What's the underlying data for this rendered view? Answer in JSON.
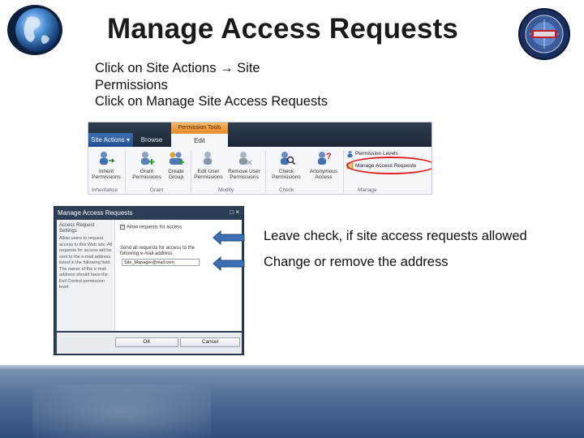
{
  "slide": {
    "title": "Manage Access Requests",
    "instructions": [
      "Click on Site Actions → Site",
      "Permissions",
      "Click on Manage Site Access Requests"
    ],
    "captions": [
      "Leave check, if site access requests allowed",
      "Change or remove  the address"
    ]
  },
  "ribbon": {
    "context_tab": "Permission Tools",
    "site_actions": "Site Actions ▾",
    "tab_browse": "Browse",
    "tab_edit": "Edit",
    "buttons": [
      {
        "label1": "Inherit",
        "label2": "Permissions",
        "icon": "inherit-permissions-icon"
      },
      {
        "label1": "Grant",
        "label2": "Permissions",
        "icon": "grant-permissions-icon"
      },
      {
        "label1": "Create",
        "label2": "Group",
        "icon": "create-group-icon"
      },
      {
        "label1": "Edit User",
        "label2": "Permissions",
        "icon": "edit-user-icon"
      },
      {
        "label1": "Remove User",
        "label2": "Permissions",
        "icon": "remove-user-icon"
      },
      {
        "label1": "Check",
        "label2": "Permissions",
        "icon": "check-permissions-icon"
      },
      {
        "label1": "Anonymous",
        "label2": "Access",
        "icon": "anonymous-access-icon"
      }
    ],
    "permission_levels": "Permission Levels",
    "manage_access_requests": "Manage Access Requests",
    "groups": [
      "Inheritance",
      "Grant",
      "Modify",
      "Check",
      "Manage"
    ]
  },
  "dialog": {
    "title": "Manage Access Requests",
    "controls": "□ ×",
    "left_heading": "Access Request Settings",
    "left_text": "Allow users to request access to this Web site. All requests for access will be sent to the e-mail address listed in the following field. The owner of the e-mail address should have the Full Control permission level.",
    "checkbox_label": "Allow requests for access",
    "checkbox_mark": "✓",
    "send_text": "Send all requests for access to the following e-mail address:",
    "email_value": "Site_Manager@mail.com",
    "ok_label": "OK",
    "cancel_label": "Cancel"
  },
  "colors": {
    "title_text": "#1a1a1a",
    "arrow_blue": "#3d6fb5",
    "highlight_red": "#e21b1b",
    "band_blue": "#4f6d95"
  }
}
